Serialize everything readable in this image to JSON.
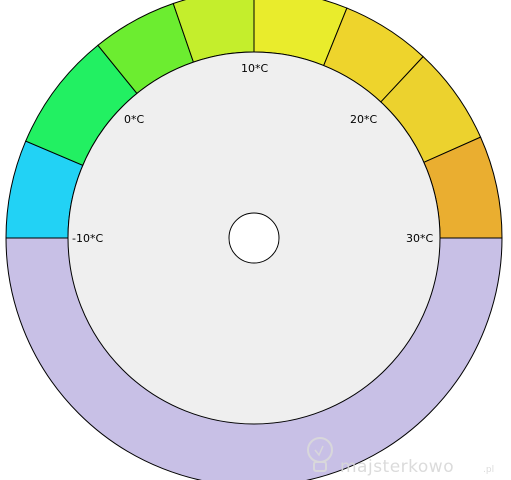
{
  "dial": {
    "labels": {
      "minus10": "-10*C",
      "zero": "0*C",
      "ten": "10*C",
      "twenty": "20*C",
      "thirty": "30*C"
    },
    "colors": {
      "segment_cyan": "#22d2f5",
      "segment_green": "#22f062",
      "segment_lime": "#6ced30",
      "segment_yellowgreen": "#c4ee2c",
      "segment_yellow": "#e9ec2c",
      "segment_amber1": "#eed42c",
      "segment_amber2": "#ecd22e",
      "segment_orange": "#eaae30",
      "lower_band": "#c8c0e6",
      "inner_disc": "#efefef",
      "hub": "#ffffff"
    }
  },
  "watermark": {
    "brand": "majsterkowo",
    "suffix": ".pl"
  }
}
